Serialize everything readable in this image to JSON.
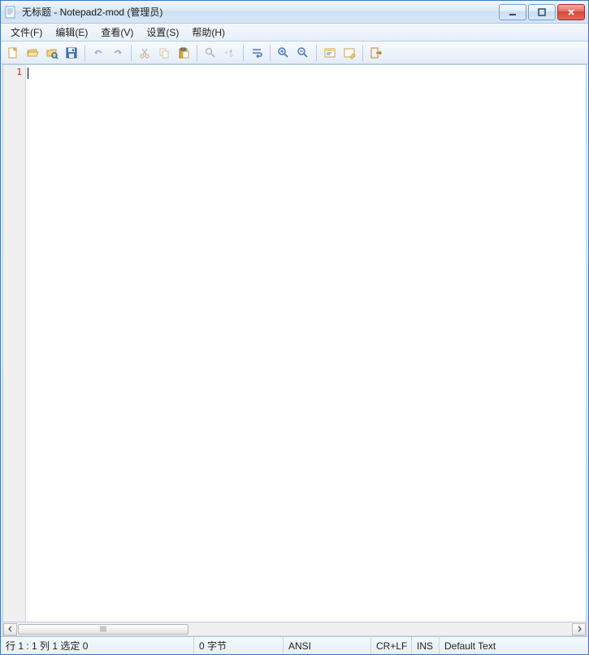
{
  "titlebar": {
    "title": "无标题 - Notepad2-mod (管理员)"
  },
  "menu": {
    "file": "文件(F)",
    "edit": "编辑(E)",
    "view": "查看(V)",
    "settings": "设置(S)",
    "help": "帮助(H)"
  },
  "editor": {
    "line_number": "1",
    "content": ""
  },
  "status": {
    "position": "行 1 : 1  列 1  选定 0",
    "bytes": "0 字节",
    "encoding": "ANSI",
    "lineending": "CR+LF",
    "insertmode": "INS",
    "scheme": "Default Text"
  }
}
